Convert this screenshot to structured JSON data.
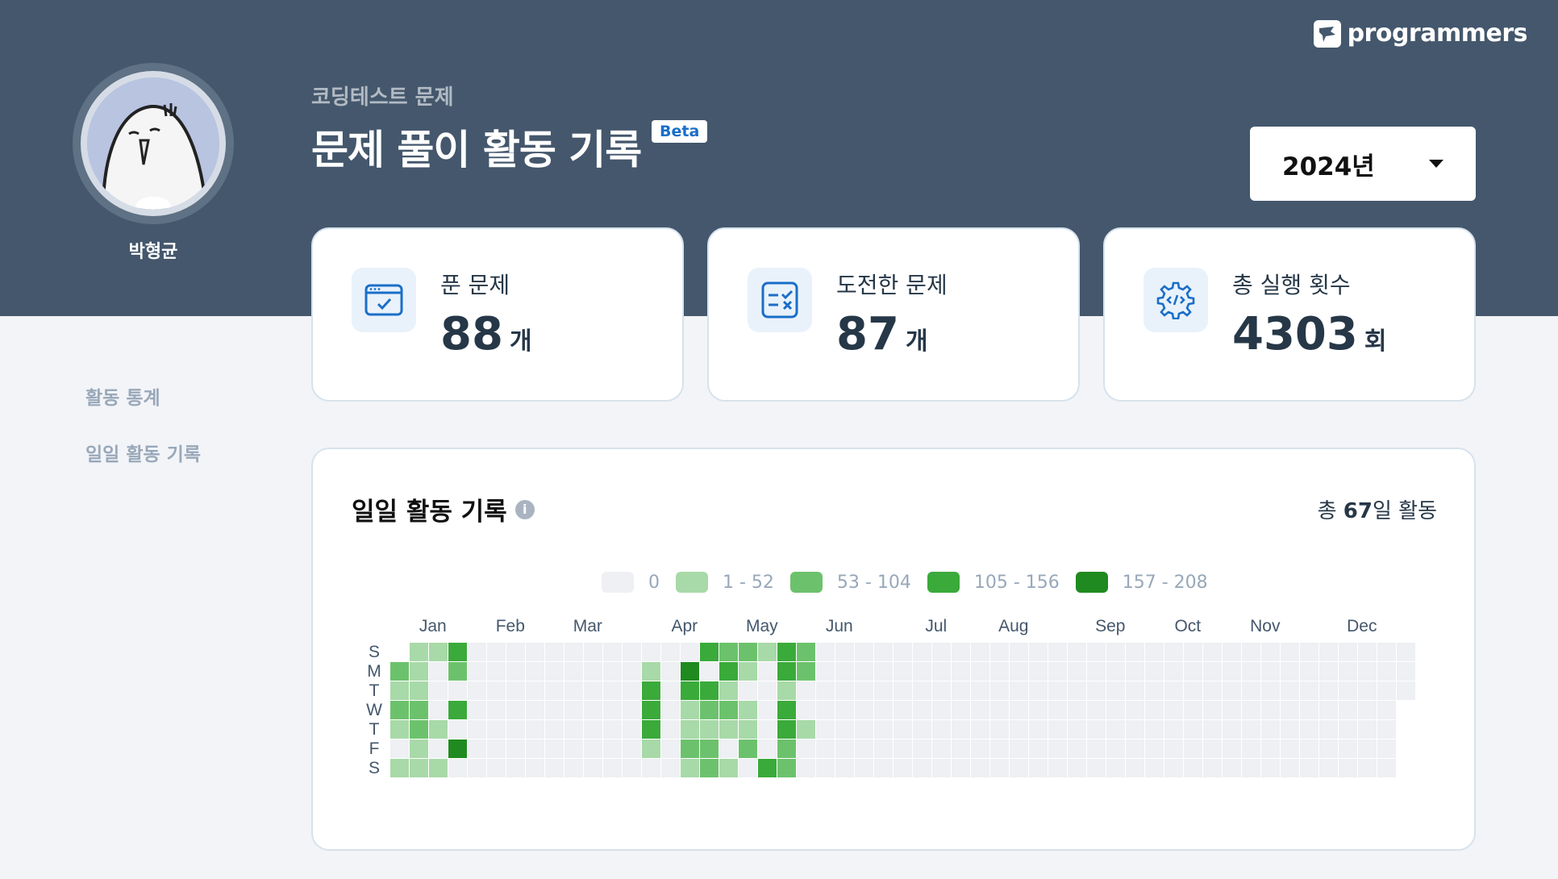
{
  "brand": {
    "name": "programmers"
  },
  "user": {
    "name": "박형균"
  },
  "header": {
    "subtitle": "코딩테스트 문제",
    "title": "문제 풀이 활동 기록",
    "badge": "Beta"
  },
  "year_select": {
    "value": "2024년"
  },
  "stats": [
    {
      "label": "푼 문제",
      "value": "88",
      "unit": "개",
      "icon": "solved-problem-icon"
    },
    {
      "label": "도전한 문제",
      "value": "87",
      "unit": "개",
      "icon": "challenged-problem-icon"
    },
    {
      "label": "총 실행 횟수",
      "value": "4303",
      "unit": "회",
      "icon": "execution-gear-icon"
    }
  ],
  "side_nav": [
    {
      "label": "활동 통계"
    },
    {
      "label": "일일 활동 기록"
    }
  ],
  "activity": {
    "title": "일일 활동 기록",
    "total_prefix": "총 ",
    "total_count": "67",
    "total_suffix": "일 활동"
  },
  "legend": [
    {
      "label": "0",
      "color": "#eef0f3"
    },
    {
      "label": "1 - 52",
      "color": "#a8d9a8"
    },
    {
      "label": "53 - 104",
      "color": "#6cc26c"
    },
    {
      "label": "105 - 156",
      "color": "#3aaa3a"
    },
    {
      "label": "157 - 208",
      "color": "#1f8a1f"
    }
  ],
  "heatmap": {
    "year": 2024,
    "months": [
      "Jan",
      "Feb",
      "Mar",
      "Apr",
      "May",
      "Jun",
      "Jul",
      "Aug",
      "Sep",
      "Oct",
      "Nov",
      "Dec"
    ],
    "weekdays": [
      "S",
      "M",
      "T",
      "W",
      "T",
      "F",
      "S"
    ],
    "level_colors": [
      "#eef0f3",
      "#a8d9a8",
      "#6cc26c",
      "#3aaa3a",
      "#1f8a1f"
    ],
    "active_days": [
      {
        "date": "01-01",
        "level": 2
      },
      {
        "date": "01-02",
        "level": 1
      },
      {
        "date": "01-03",
        "level": 2
      },
      {
        "date": "01-04",
        "level": 1
      },
      {
        "date": "01-06",
        "level": 1
      },
      {
        "date": "01-07",
        "level": 1
      },
      {
        "date": "01-08",
        "level": 1
      },
      {
        "date": "01-09",
        "level": 1
      },
      {
        "date": "01-10",
        "level": 2
      },
      {
        "date": "01-11",
        "level": 2
      },
      {
        "date": "01-12",
        "level": 1
      },
      {
        "date": "01-13",
        "level": 1
      },
      {
        "date": "01-14",
        "level": 1
      },
      {
        "date": "01-18",
        "level": 1
      },
      {
        "date": "01-20",
        "level": 1
      },
      {
        "date": "01-21",
        "level": 3
      },
      {
        "date": "01-22",
        "level": 2
      },
      {
        "date": "01-24",
        "level": 3
      },
      {
        "date": "01-26",
        "level": 4
      },
      {
        "date": "04-01",
        "level": 1
      },
      {
        "date": "04-02",
        "level": 3
      },
      {
        "date": "04-03",
        "level": 3
      },
      {
        "date": "04-04",
        "level": 3
      },
      {
        "date": "04-05",
        "level": 1
      },
      {
        "date": "04-15",
        "level": 4
      },
      {
        "date": "04-16",
        "level": 3
      },
      {
        "date": "04-17",
        "level": 1
      },
      {
        "date": "04-18",
        "level": 1
      },
      {
        "date": "04-19",
        "level": 2
      },
      {
        "date": "04-20",
        "level": 1
      },
      {
        "date": "04-21",
        "level": 3
      },
      {
        "date": "04-23",
        "level": 3
      },
      {
        "date": "04-24",
        "level": 2
      },
      {
        "date": "04-25",
        "level": 1
      },
      {
        "date": "04-26",
        "level": 2
      },
      {
        "date": "04-27",
        "level": 2
      },
      {
        "date": "04-28",
        "level": 2
      },
      {
        "date": "04-29",
        "level": 3
      },
      {
        "date": "04-30",
        "level": 1
      },
      {
        "date": "05-01",
        "level": 2
      },
      {
        "date": "05-02",
        "level": 1
      },
      {
        "date": "05-04",
        "level": 1
      },
      {
        "date": "05-05",
        "level": 2
      },
      {
        "date": "05-06",
        "level": 1
      },
      {
        "date": "05-08",
        "level": 1
      },
      {
        "date": "05-09",
        "level": 1
      },
      {
        "date": "05-10",
        "level": 2
      },
      {
        "date": "05-12",
        "level": 1
      },
      {
        "date": "05-18",
        "level": 3
      },
      {
        "date": "05-19",
        "level": 3
      },
      {
        "date": "05-20",
        "level": 3
      },
      {
        "date": "05-21",
        "level": 1
      },
      {
        "date": "05-22",
        "level": 3
      },
      {
        "date": "05-23",
        "level": 3
      },
      {
        "date": "05-24",
        "level": 2
      },
      {
        "date": "05-25",
        "level": 2
      },
      {
        "date": "05-26",
        "level": 2
      },
      {
        "date": "05-27",
        "level": 2
      },
      {
        "date": "05-30",
        "level": 1
      }
    ]
  }
}
